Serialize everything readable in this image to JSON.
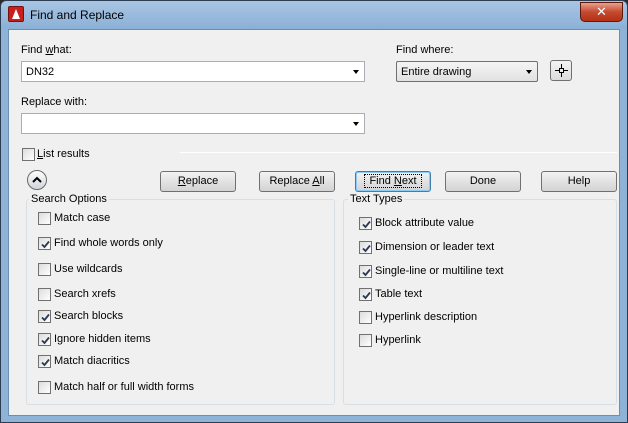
{
  "window": {
    "title": "Find and Replace",
    "close_label": "✕"
  },
  "find_what": {
    "label_pre": "Find ",
    "label_u": "w",
    "label_post": "hat:",
    "value": "DN32"
  },
  "find_where": {
    "label": "Find where:",
    "value": "Entire drawing"
  },
  "replace_with": {
    "label": "Replace with:",
    "value": ""
  },
  "list_results": {
    "label_u": "L",
    "label_post": "ist results",
    "checked": false
  },
  "buttons": {
    "replace": "Replace",
    "replace_all": "Replace All",
    "find_next": "Find Next",
    "done": "Done",
    "help": "Help"
  },
  "search_options": {
    "title": "Search Options",
    "items": [
      {
        "label": "Match case",
        "checked": false
      },
      {
        "label": "Find whole words only",
        "checked": true
      },
      {
        "label": "Use wildcards",
        "checked": false
      },
      {
        "label": "Search xrefs",
        "checked": false
      },
      {
        "label": "Search blocks",
        "checked": true
      },
      {
        "label": "Ignore hidden items",
        "checked": true
      },
      {
        "label": "Match diacritics",
        "checked": true
      },
      {
        "label": "Match half or full width forms",
        "checked": false
      }
    ]
  },
  "text_types": {
    "title": "Text Types",
    "items": [
      {
        "label": "Block attribute value",
        "checked": true
      },
      {
        "label": "Dimension or leader text",
        "checked": true
      },
      {
        "label": "Single-line or multiline text",
        "checked": true
      },
      {
        "label": "Table text",
        "checked": true
      },
      {
        "label": "Hyperlink description",
        "checked": false
      },
      {
        "label": "Hyperlink",
        "checked": false
      }
    ]
  },
  "icons": {
    "app": "autocad-logo-icon",
    "pick": "crosshair-pick-icon",
    "collapse": "chevron-up-icon",
    "check": "checkmark-icon"
  }
}
